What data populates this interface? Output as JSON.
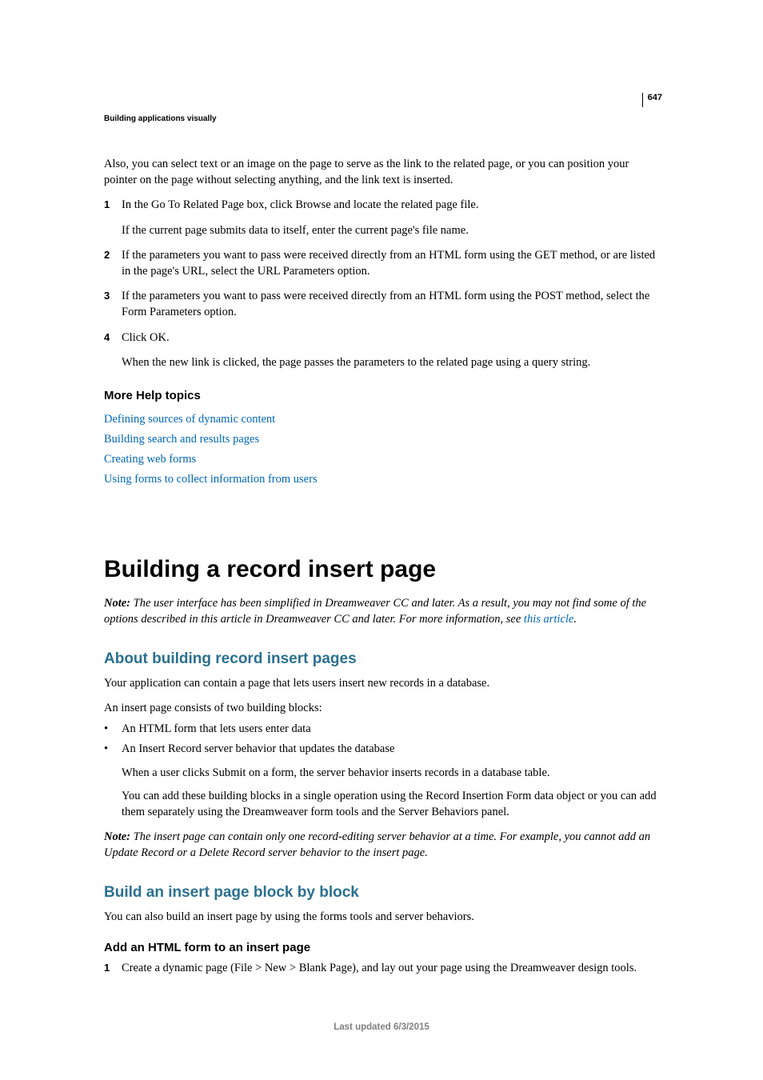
{
  "pageNumber": "647",
  "sectionHeader": "Building applications visually",
  "intro": "Also, you can select text or an image on the page to serve as the link to the related page, or you can position your pointer on the page without selecting anything, and the link text is inserted.",
  "steps": [
    {
      "num": "1",
      "text": "In the Go To Related Page box, click Browse and locate the related page file.",
      "sub": "If the current page submits data to itself, enter the current page's file name."
    },
    {
      "num": "2",
      "text": "If the parameters you want to pass were received directly from an HTML form using the GET method, or are listed in the page's URL, select the URL Parameters option."
    },
    {
      "num": "3",
      "text": "If the parameters you want to pass were received directly from an HTML form using the POST method, select the Form Parameters option."
    },
    {
      "num": "4",
      "text": "Click OK.",
      "sub": "When the new link is clicked, the page passes the parameters to the related page using a query string."
    }
  ],
  "moreHelpHeading": "More Help topics",
  "helpLinks": [
    "Defining sources of dynamic content",
    "Building search and results pages",
    "Creating web forms",
    "Using forms to collect information from users"
  ],
  "pageTitle": "Building a record insert page",
  "mainNote": {
    "label": "Note: ",
    "textBefore": "The user interface has been simplified in Dreamweaver CC and later. As a result, you may not find some of the options described in this article in Dreamweaver CC and later. For more information, see ",
    "link": "this article",
    "textAfter": "."
  },
  "aboutHeading": "About building record insert pages",
  "aboutP1": "Your application can contain a page that lets users insert new records in a database.",
  "aboutP2": "An insert page consists of two building blocks:",
  "bullets": [
    {
      "text": "An HTML form that lets users enter data"
    },
    {
      "text": "An Insert Record server behavior that updates the database",
      "sub1": "When a user clicks Submit on a form, the server behavior inserts records in a database table.",
      "sub2": "You can add these building blocks in a single operation using the Record Insertion Form data object or you can add them separately using the Dreamweaver form tools and the Server Behaviors panel."
    }
  ],
  "insertNote": {
    "label": "Note: ",
    "text": "The insert page can contain only one record-editing server behavior at a time. For example, you cannot add an Update Record or a Delete Record server behavior to the insert page."
  },
  "buildHeading": "Build an insert page block by block",
  "buildP1": "You can also build an insert page by using the forms tools and server behaviors.",
  "addHtmlHeading": "Add an HTML form to an insert page",
  "addHtmlStep": {
    "num": "1",
    "text": "Create a dynamic page (File > New > Blank Page), and lay out your page using the Dreamweaver design tools."
  },
  "footer": "Last updated 6/3/2015"
}
